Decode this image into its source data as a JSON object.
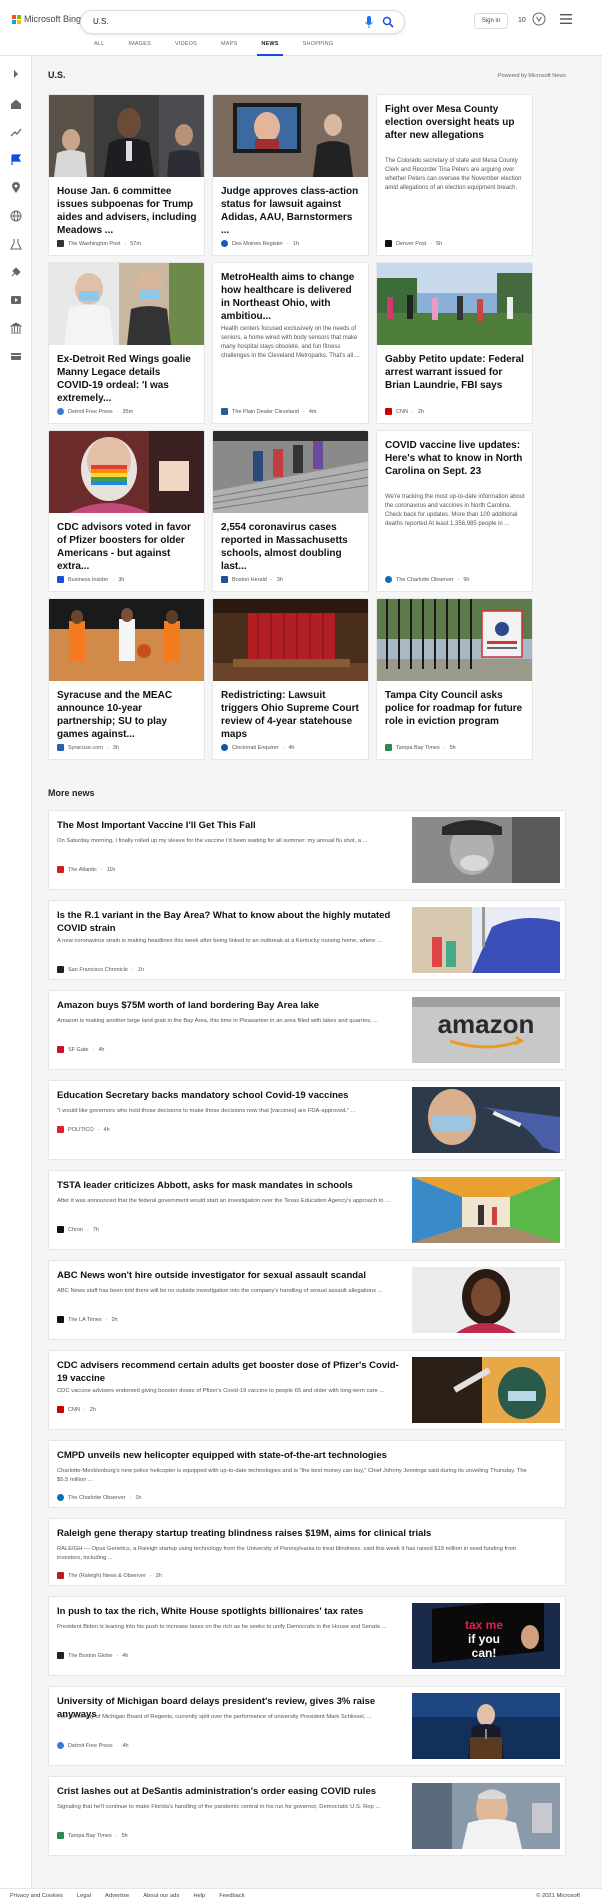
{
  "header": {
    "logo_text": "Microsoft Bing",
    "search_value": "U.S.",
    "signin_label": "Sign in",
    "rewards_count": "10",
    "tabs": [
      "ALL",
      "IMAGES",
      "VIDEOS",
      "MAPS",
      "NEWS",
      "SHOPPING"
    ],
    "active_tab": "NEWS"
  },
  "sidebar": {
    "icons": [
      "expand-icon",
      "home-icon",
      "trending-icon",
      "us-flag-icon",
      "location-icon",
      "world-icon",
      "science-icon",
      "technology-icon",
      "entertainment-icon",
      "politics-icon",
      "business-icon"
    ]
  },
  "main": {
    "section_title": "U.S.",
    "powered_by": "Powered by Microsoft News",
    "cards": [
      {
        "title": "House Jan. 6 committee issues subpoenas for Trump aides and advisers, including Meadows ...",
        "source": "The Washington Post",
        "time": "57m",
        "favicon_color": "#333333",
        "image": "photo-press-conference"
      },
      {
        "title": "Judge approves class-action status for lawsuit against Adidas, AAU, Barnstormers ...",
        "source": "Des Moines Register",
        "time": "1h",
        "favicon_color": "#1a56c4",
        "image": "photo-man-in-courtroom"
      },
      {
        "title": "Fight over Mesa County election oversight heats up after new allegations",
        "desc": "The Colorado secretary of state and Mesa County Clerk and Recorder Tina Peters are arguing over whether Peters can oversee the November election amid allegations of an election equipment breach.",
        "source": "Denver Post",
        "time": "5h",
        "favicon_color": "#111111"
      },
      {
        "title": "Ex-Detroit Red Wings goalie Manny Legace details COVID-19 ordeal: 'I was extremely...",
        "source": "Detroit Free Press",
        "time": "35m",
        "favicon_color": "#3a7bd5",
        "image": "photo-hospital-masks"
      },
      {
        "title": "MetroHealth aims to change how healthcare is delivered in Northeast Ohio, with ambitiou...",
        "desc": "Health centers focused exclusively on the needs of seniors, a home wired with body sensors that make many hospital stays obsolete, and fun fitness challenges in the Cleveland Metroparks. That's all ...",
        "source": "The Plain Dealer Cleveland",
        "time": "4m",
        "favicon_color": "#2a5d8f"
      },
      {
        "title": "Gabby Petito update: Federal arrest warrant issued for Brian Laundrie, FBI says",
        "source": "CNN",
        "time": "2h",
        "favicon_color": "#cc0000",
        "image": "photo-vigil-crowd"
      },
      {
        "title": "CDC advisors voted in favor of Pfizer boosters for older Americans - but against extra...",
        "source": "Business Insider",
        "time": "3h",
        "favicon_color": "#1b4fd8",
        "image": "photo-vaccine-rainbow-mask"
      },
      {
        "title": "2,554 coronavirus cases reported in Massachusetts schools, almost doubling last...",
        "source": "Boston Herald",
        "time": "3h",
        "favicon_color": "#1f4f9c",
        "image": "photo-school-stairs"
      },
      {
        "title": "COVID vaccine live updates: Here's what to know in North Carolina on Sept. 23",
        "desc": "We're tracking the most up-to-date information about the coronavirus and vaccines in North Carolina. Check back for updates. More than 100 additional deaths reported At least 1,356,985 people in ...",
        "source": "The Charlotte Observer",
        "time": "9h",
        "favicon_color": "#0b6fb3"
      },
      {
        "title": "Syracuse and the MEAC announce 10-year partnership; SU to play games against...",
        "source": "Syracuse.com",
        "time": "3h",
        "favicon_color": "#2b5fa8",
        "image": "photo-basketball"
      },
      {
        "title": "Redistricting: Lawsuit triggers Ohio Supreme Court review of 4-year statehouse maps",
        "source": "Cincinnati Enquirer",
        "time": "4h",
        "favicon_color": "#1450a8",
        "image": "photo-courtroom-curtain"
      },
      {
        "title": "Tampa City Council asks police for roadmap for future role in eviction program",
        "source": "Tampa Bay Times",
        "time": "5h",
        "favicon_color": "#2e8b57",
        "image": "photo-police-sign"
      }
    ]
  },
  "more_news": {
    "title": "More news",
    "items": [
      {
        "title": "The Most Important Vaccine I'll Get This Fall",
        "desc": "On Saturday morning, I finally rolled up my sleeve for the vaccine I'd been waiting for all summer: my annual flu shot, a ...",
        "source": "The Atlantic",
        "time": "11h",
        "favicon_color": "#d02020",
        "image": "photo-sneeze"
      },
      {
        "title": "Is the R.1 variant in the Bay Area? What to know about the highly mutated COVID strain",
        "desc": "A new coronavirus strain is making headlines this week after being linked to an outbreak at a Kentucky nursing home, where ...",
        "source": "San Francisco Chronicle",
        "time": "1h",
        "favicon_color": "#222222",
        "image": "photo-lab-pipette"
      },
      {
        "title": "Amazon buys $75M worth of land bordering Bay Area lake",
        "desc": "Amazon is making another large land grab in the Bay Area, this time in Pleasanton in an area filled with lakes and quarries, ...",
        "source": "SF Gate",
        "time": "4h",
        "favicon_color": "#c8102e",
        "image": "photo-amazon-sign",
        "image_text": "amazon"
      },
      {
        "title": "Education Secretary backs mandatory school Covid-19 vaccines",
        "desc": "\"I would like governors who hold those decisions to make those decisions now that [vaccines] are FDA-approved.\" ...",
        "source": "POLITICO",
        "time": "4h",
        "favicon_color": "#e0202a",
        "image": "photo-vaccination"
      },
      {
        "title": "TSTA leader criticizes Abbott, asks for mask mandates in schools",
        "desc": "After it was announced that the federal government would start an investigation over the Texas Education Agency's approach to ...",
        "source": "Chron",
        "time": "7h",
        "favicon_color": "#111111",
        "image": "photo-school-hallway"
      },
      {
        "title": "ABC News won't hire outside investigator for sexual assault scandal",
        "desc": "ABC News staff has been told there will be no outside investigation into the company's handling of sexual assault allegations ...",
        "source": "The LA Times",
        "time": "2h",
        "favicon_color": "#111111",
        "image": "photo-woman-portrait"
      },
      {
        "title": "CDC advisers recommend certain adults get booster dose of Pfizer's Covid-19 vaccine",
        "desc": "CDC vaccine advisers endorsed giving booster doses of Pfizer's Covid-19 vaccine to people 65 and older with long-term care ...",
        "source": "CNN",
        "time": "2h",
        "favicon_color": "#cc0000",
        "image": "photo-syringe"
      },
      {
        "title": "CMPD unveils new helicopter equipped with state-of-the-art technologies",
        "desc": "Charlotte-Mecklenburg's new police helicopter is equipped with up-to-date technologies and is \"the best money can buy,\" Chief Johnny Jennings said during its unveiling Thursday. The $5.5 million ...",
        "source": "The Charlotte Observer",
        "time": "1h",
        "favicon_color": "#0b6fb3"
      },
      {
        "title": "Raleigh gene therapy startup treating blindness raises $19M, aims for clinical trials",
        "desc": "RALEIGH — Opus Genetics, a Raleigh startup using technology from the University of Pennsylvania to treat blindness, said this week it has raised $19 million in seed funding from investors, including ...",
        "source": "The (Raleigh) News & Observer",
        "time": "2h",
        "favicon_color": "#b22222"
      },
      {
        "title": "In push to tax the rich, White House spotlights billionaires' tax rates",
        "desc": "President Biden is leaning into his push to increase taxes on the rich as he seeks to unify Democrats in the House and Senate ...",
        "source": "The Boston Globe",
        "time": "4h",
        "favicon_color": "#222222",
        "image": "photo-tax-billboard",
        "image_text_1": "tax me",
        "image_text_2": "if you",
        "image_text_3": "can!"
      },
      {
        "title": "University of Michigan board delays president's review, gives 3% raise anyways",
        "desc": "The University of Michigan Board of Regents, currently split over the performance of university President Mark Schlissel, ...",
        "source": "Detroit Free Press",
        "time": "4h",
        "favicon_color": "#3a7bd5",
        "image": "photo-podium-speaker"
      },
      {
        "title": "Crist lashes out at DeSantis administration's order easing COVID rules",
        "desc": "Signaling that he'll continue to make Florida's handling of the pandemic central in his run for governor, Democratic U.S. Rep ...",
        "source": "Tampa Bay Times",
        "time": "5h",
        "favicon_color": "#2e8b57",
        "image": "photo-man-with-mask"
      }
    ]
  },
  "footer": {
    "links": [
      "Privacy and Cookies",
      "Legal",
      "Advertise",
      "About our ads",
      "Help",
      "Feedback"
    ],
    "copyright": "© 2021 Microsoft"
  },
  "colors": {
    "accent": "#174ae4",
    "ms_red": "#f25022",
    "ms_green": "#7fba00",
    "ms_blue": "#00a4ef",
    "ms_yellow": "#ffb900"
  }
}
